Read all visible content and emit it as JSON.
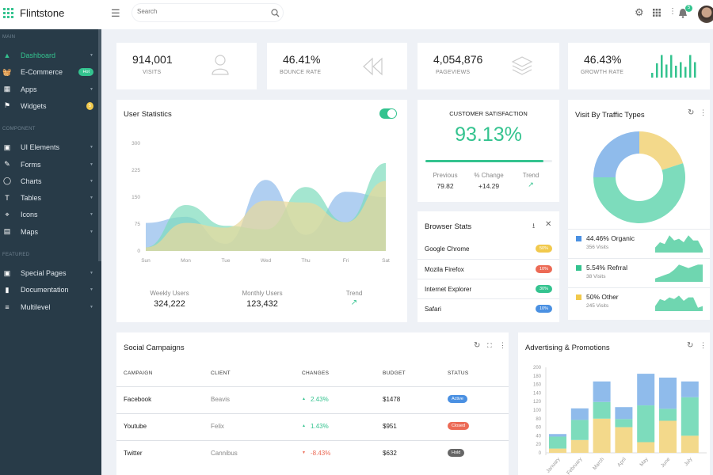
{
  "app": {
    "title": "Flintstone",
    "search_placeholder": "Search",
    "notifications": "5"
  },
  "colors": {
    "accent": "#34c38f",
    "sidebar": "#283b48",
    "blue": "#8fbbeb",
    "green": "#7ddcbc",
    "yellow": "#f3d98b"
  },
  "sidebar": {
    "sections": [
      {
        "label": "MAIN",
        "items": [
          {
            "label": "Dashboard",
            "icon": "chart-area-icon",
            "active": true
          },
          {
            "label": "E-Commerce",
            "icon": "basket-icon",
            "badge": "Hot"
          },
          {
            "label": "Apps",
            "icon": "grid-icon"
          },
          {
            "label": "Widgets",
            "icon": "flag-icon",
            "badge": "5"
          }
        ]
      },
      {
        "label": "COMPONENT",
        "items": [
          {
            "label": "UI Elements",
            "icon": "ui-icon"
          },
          {
            "label": "Forms",
            "icon": "pencil-icon"
          },
          {
            "label": "Charts",
            "icon": "donut-icon"
          },
          {
            "label": "Tables",
            "icon": "text-icon"
          },
          {
            "label": "Icons",
            "icon": "icons-icon"
          },
          {
            "label": "Maps",
            "icon": "map-icon"
          }
        ]
      },
      {
        "label": "FEATURED",
        "items": [
          {
            "label": "Special Pages",
            "icon": "pages-icon"
          },
          {
            "label": "Documentation",
            "icon": "book-icon"
          },
          {
            "label": "Multilevel",
            "icon": "filter-icon"
          }
        ]
      }
    ]
  },
  "stats": [
    {
      "value": "914,001",
      "label": "VISITS",
      "icon": "user-icon"
    },
    {
      "value": "46.41%",
      "label": "BOUNCE RATE",
      "icon": "rewind-icon"
    },
    {
      "value": "4,054,876",
      "label": "PAGEVIEWS",
      "icon": "layers-icon"
    },
    {
      "value": "46.43%",
      "label": "GROWTH RATE",
      "icon": "bar-chart-icon"
    }
  ],
  "growth_bars": [
    0.2,
    0.6,
    0.95,
    0.55,
    0.95,
    0.5,
    0.65,
    0.45,
    0.95,
    0.65
  ],
  "user_stats": {
    "title": "User Statistics",
    "toggle_on": true,
    "summary": [
      {
        "label": "Weekly Users",
        "value": "324,222"
      },
      {
        "label": "Monthly Users",
        "value": "123,432"
      },
      {
        "label": "Trend",
        "value": ""
      }
    ]
  },
  "satisfaction": {
    "title": "CUSTOMER SATISFACTION",
    "value": "93.13%",
    "progress": 93.13,
    "items": [
      {
        "label": "Previous",
        "value": "79.82"
      },
      {
        "label": "% Change",
        "value": "+14.29"
      },
      {
        "label": "Trend",
        "value": ""
      }
    ]
  },
  "browser_stats": {
    "title": "Browser Stats",
    "rows": [
      {
        "name": "Google Chrome",
        "pct": "50%",
        "color": "#f1c94c"
      },
      {
        "name": "Mozila Firefox",
        "pct": "10%",
        "color": "#ec6a55"
      },
      {
        "name": "Internet Explorer",
        "pct": "30%",
        "color": "#34c38f"
      },
      {
        "name": "Safari",
        "pct": "10%",
        "color": "#4a90e2"
      }
    ]
  },
  "traffic": {
    "title": "Visit By Traffic Types",
    "rows": [
      {
        "label": "44.46% Organic",
        "sub": "356 Visits",
        "color": "#4a90e2",
        "spark": [
          2,
          5,
          4,
          9,
          6,
          7,
          5,
          9,
          6,
          6,
          1
        ]
      },
      {
        "label": "5.54% Refrral",
        "sub": "38 Visits",
        "color": "#34c38f",
        "spark": [
          1,
          2,
          3,
          4,
          6,
          9,
          8,
          7,
          8,
          9,
          9
        ]
      },
      {
        "label": "50% Other",
        "sub": "245 Visits",
        "color": "#f1c94c",
        "spark": [
          2,
          6,
          5,
          7,
          6,
          8,
          5,
          7,
          7,
          1,
          2
        ]
      }
    ]
  },
  "campaigns": {
    "title": "Social Campaigns",
    "headers": [
      "CAMPAIGN",
      "CLIENT",
      "CHANGES",
      "BUDGET",
      "STATUS"
    ],
    "rows": [
      {
        "campaign": "Facebook",
        "client": "Beavis",
        "change": "2.43%",
        "dir": "up",
        "budget": "$1478",
        "status": "Active",
        "status_color": "#4a90e2"
      },
      {
        "campaign": "Youtube",
        "client": "Felix",
        "change": "1.43%",
        "dir": "up",
        "budget": "$951",
        "status": "Closed",
        "status_color": "#ec6a55"
      },
      {
        "campaign": "Twitter",
        "client": "Cannibus",
        "change": "-8.43%",
        "dir": "down",
        "budget": "$632",
        "status": "Hold",
        "status_color": "#666666"
      }
    ]
  },
  "chart_data": [
    {
      "type": "area",
      "title": "User Statistics",
      "categories": [
        "Sun",
        "Mon",
        "Tue",
        "Wed",
        "Thu",
        "Fri",
        "Sat"
      ],
      "ylim": [
        0,
        300
      ],
      "yticks": [
        0,
        75,
        150,
        225,
        300
      ],
      "series": [
        {
          "values": [
            78,
            95,
            20,
            198,
            45,
            165,
            150
          ],
          "color": "#8fbbeb"
        },
        {
          "values": [
            10,
            128,
            70,
            60,
            178,
            80,
            245
          ],
          "color": "#7ddcbc"
        },
        {
          "values": [
            10,
            78,
            65,
            140,
            135,
            80,
            195
          ],
          "color": "#e9d99a"
        }
      ]
    },
    {
      "type": "pie",
      "title": "Visit By Traffic Types",
      "categories": [
        "Other",
        "Refrral",
        "Organic"
      ],
      "values": [
        20,
        55,
        25
      ],
      "colors": [
        "#f3d98b",
        "#7ddcbc",
        "#8fbbeb"
      ],
      "donut": true
    },
    {
      "type": "bar",
      "stacked": true,
      "title": "Advertising & Promotions",
      "categories": [
        "January",
        "February",
        "March",
        "April",
        "May",
        "June",
        "July"
      ],
      "ylim": [
        0,
        200
      ],
      "yticks": [
        0,
        20,
        40,
        60,
        80,
        100,
        120,
        140,
        160,
        180,
        200
      ],
      "series": [
        {
          "values": [
            10,
            30,
            80,
            60,
            25,
            75,
            40
          ],
          "color": "#f3d98b"
        },
        {
          "values": [
            28,
            47,
            39,
            19,
            86,
            28,
            90
          ],
          "color": "#7ddcbc"
        },
        {
          "values": [
            6,
            27,
            48,
            28,
            74,
            73,
            37
          ],
          "color": "#8fbbeb"
        }
      ]
    }
  ]
}
